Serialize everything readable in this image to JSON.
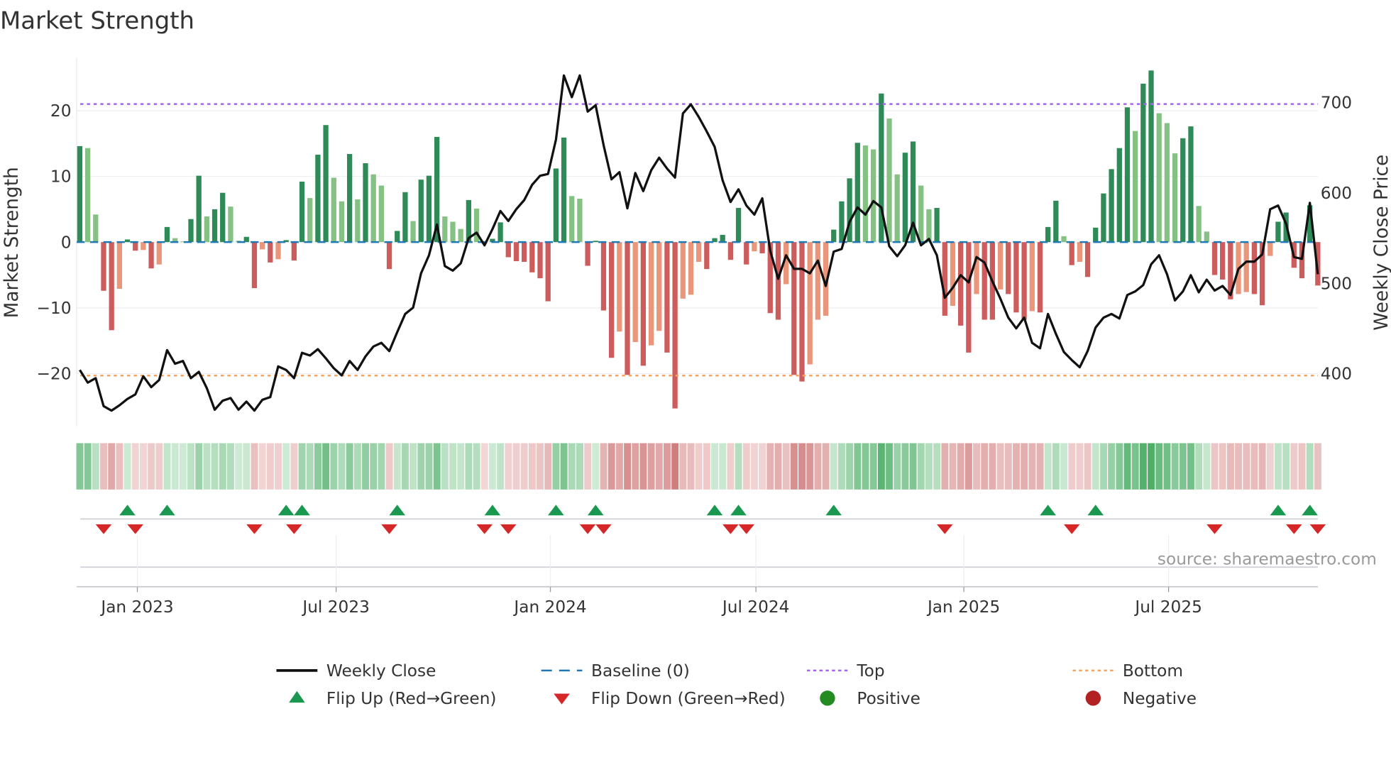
{
  "chart_data": {
    "type": "bar",
    "title": "Market Strength",
    "ylabel": "Market Strength",
    "y2label": "Weekly Close Price",
    "ylim": [
      -28,
      28
    ],
    "y2lim": [
      330,
      747
    ],
    "yticks": [
      {
        "value": 20,
        "label": "20"
      },
      {
        "value": 10,
        "label": "10"
      },
      {
        "value": 0,
        "label": "0"
      },
      {
        "value": -10,
        "label": "−10"
      },
      {
        "value": -20,
        "label": "−20"
      }
    ],
    "y2ticks": [
      {
        "value": 700,
        "label": "700"
      },
      {
        "value": 600,
        "label": "600"
      },
      {
        "value": 500,
        "label": "500"
      },
      {
        "value": 400,
        "label": "400"
      }
    ],
    "xticks": [
      {
        "week_index": 7.25,
        "label": "Jan 2023"
      },
      {
        "week_index": 32.3,
        "label": "Jul 2023"
      },
      {
        "week_index": 59.3,
        "label": "Jan 2024"
      },
      {
        "week_index": 85.2,
        "label": "Jul 2024"
      },
      {
        "week_index": 111.4,
        "label": "Jan 2025"
      },
      {
        "week_index": 137.2,
        "label": "Jul 2025"
      }
    ],
    "grid": true,
    "thresholds": {
      "top": 21.0,
      "bottom": -20.3,
      "baseline": 0
    },
    "strength": [
      14.6,
      14.3,
      4.2,
      -7.4,
      -13.4,
      -7.1,
      0.4,
      -1.3,
      -1.2,
      -4.0,
      -3.4,
      2.3,
      0.6,
      0.1,
      3.5,
      10.1,
      3.9,
      5.0,
      7.5,
      5.4,
      0.2,
      0.8,
      -7.0,
      -1.1,
      -3.1,
      -2.6,
      0.3,
      -2.8,
      9.2,
      6.7,
      13.3,
      17.8,
      9.8,
      6.2,
      13.4,
      6.5,
      12.0,
      10.3,
      8.6,
      -4.1,
      1.7,
      7.6,
      3.2,
      9.5,
      10.1,
      16.0,
      3.9,
      3.1,
      2.0,
      6.4,
      5.1,
      -0.2,
      0.5,
      3.0,
      -2.3,
      -2.9,
      -3.0,
      -4.6,
      -5.5,
      -9.0,
      11.2,
      15.9,
      7.0,
      6.6,
      -3.6,
      0.2,
      -10.4,
      -17.6,
      -13.6,
      -20.2,
      -15.2,
      -18.8,
      -15.7,
      -13.5,
      -16.8,
      -25.3,
      -8.6,
      -8.0,
      -3.0,
      -4.1,
      0.6,
      1.1,
      -2.7,
      5.2,
      -3.4,
      -1.4,
      -1.7,
      -10.8,
      -11.8,
      -6.4,
      -20.2,
      -21.2,
      -18.6,
      -11.8,
      -11.2,
      1.9,
      6.2,
      9.7,
      15.1,
      14.7,
      14.1,
      22.6,
      18.8,
      10.3,
      13.6,
      15.3,
      8.6,
      5.0,
      5.2,
      -11.2,
      -9.7,
      -12.7,
      -16.8,
      -7.9,
      -11.8,
      -11.8,
      -7.2,
      -7.9,
      -10.7,
      -11.8,
      -10.5,
      -10.7,
      2.3,
      6.3,
      0.9,
      -3.5,
      -3.0,
      -5.3,
      2.2,
      7.4,
      11.1,
      14.3,
      20.5,
      16.9,
      24.1,
      26.1,
      19.6,
      18.1,
      13.5,
      15.8,
      17.6,
      5.5,
      1.6,
      -5.0,
      -5.7,
      -8.7,
      -7.9,
      -7.6,
      -7.9,
      -9.6,
      -2.1,
      3.1,
      4.5,
      -3.9,
      -5.5,
      5.6,
      -6.6
    ],
    "weekly_close": [
      404,
      390,
      395,
      364,
      359,
      365,
      372,
      377,
      397,
      385,
      393,
      426,
      411,
      414,
      395,
      402,
      384,
      360,
      370,
      373,
      360,
      369,
      359,
      371,
      374,
      408,
      404,
      395,
      423,
      420,
      427,
      417,
      406,
      398,
      414,
      404,
      419,
      430,
      434,
      425,
      446,
      466,
      473,
      511,
      531,
      565,
      519,
      514,
      522,
      550,
      556,
      542,
      560,
      580,
      569,
      582,
      592,
      609,
      619,
      621,
      659,
      730,
      706,
      730,
      690,
      697,
      653,
      615,
      623,
      583,
      622,
      602,
      625,
      639,
      627,
      617,
      688,
      698,
      684,
      668,
      651,
      614,
      590,
      604,
      586,
      576,
      594,
      536,
      505,
      531,
      516,
      516,
      511,
      525,
      497,
      535,
      538,
      568,
      584,
      576,
      591,
      584,
      541,
      530,
      542,
      567,
      542,
      549,
      531,
      484,
      495,
      509,
      501,
      529,
      523,
      502,
      483,
      462,
      450,
      462,
      434,
      428,
      466,
      444,
      424,
      415,
      407,
      425,
      451,
      462,
      466,
      461,
      487,
      491,
      498,
      521,
      531,
      510,
      481,
      491,
      509,
      490,
      504,
      492,
      497,
      487,
      516,
      524,
      524,
      532,
      582,
      586,
      566,
      529,
      527,
      589,
      510
    ],
    "legend": [
      {
        "key": "weekly_close",
        "label": "Weekly Close"
      },
      {
        "key": "baseline",
        "label": "Baseline (0)"
      },
      {
        "key": "top",
        "label": "Top"
      },
      {
        "key": "bottom",
        "label": "Bottom"
      },
      {
        "key": "flip_up",
        "label": "Flip Up (Red→Green)"
      },
      {
        "key": "flip_down",
        "label": "Flip Down (Green→Red)"
      },
      {
        "key": "positive",
        "label": "Positive"
      },
      {
        "key": "negative",
        "label": "Negative"
      }
    ],
    "legend_placement": "bottom",
    "source": "source: sharemaestro.com",
    "colors": {
      "pos_strong": "#2e8b57",
      "pos_weak": "#86c184",
      "neg_strong": "#cd5c5c",
      "neg_weak": "#e9967a",
      "line": "#111111",
      "baseline": "#1f77b4",
      "top": "#a463f2",
      "bottom": "#f4a460",
      "flip_up": "#1a9850",
      "flip_down": "#d62728",
      "positive": "#228b22",
      "negative": "#b22222"
    }
  }
}
